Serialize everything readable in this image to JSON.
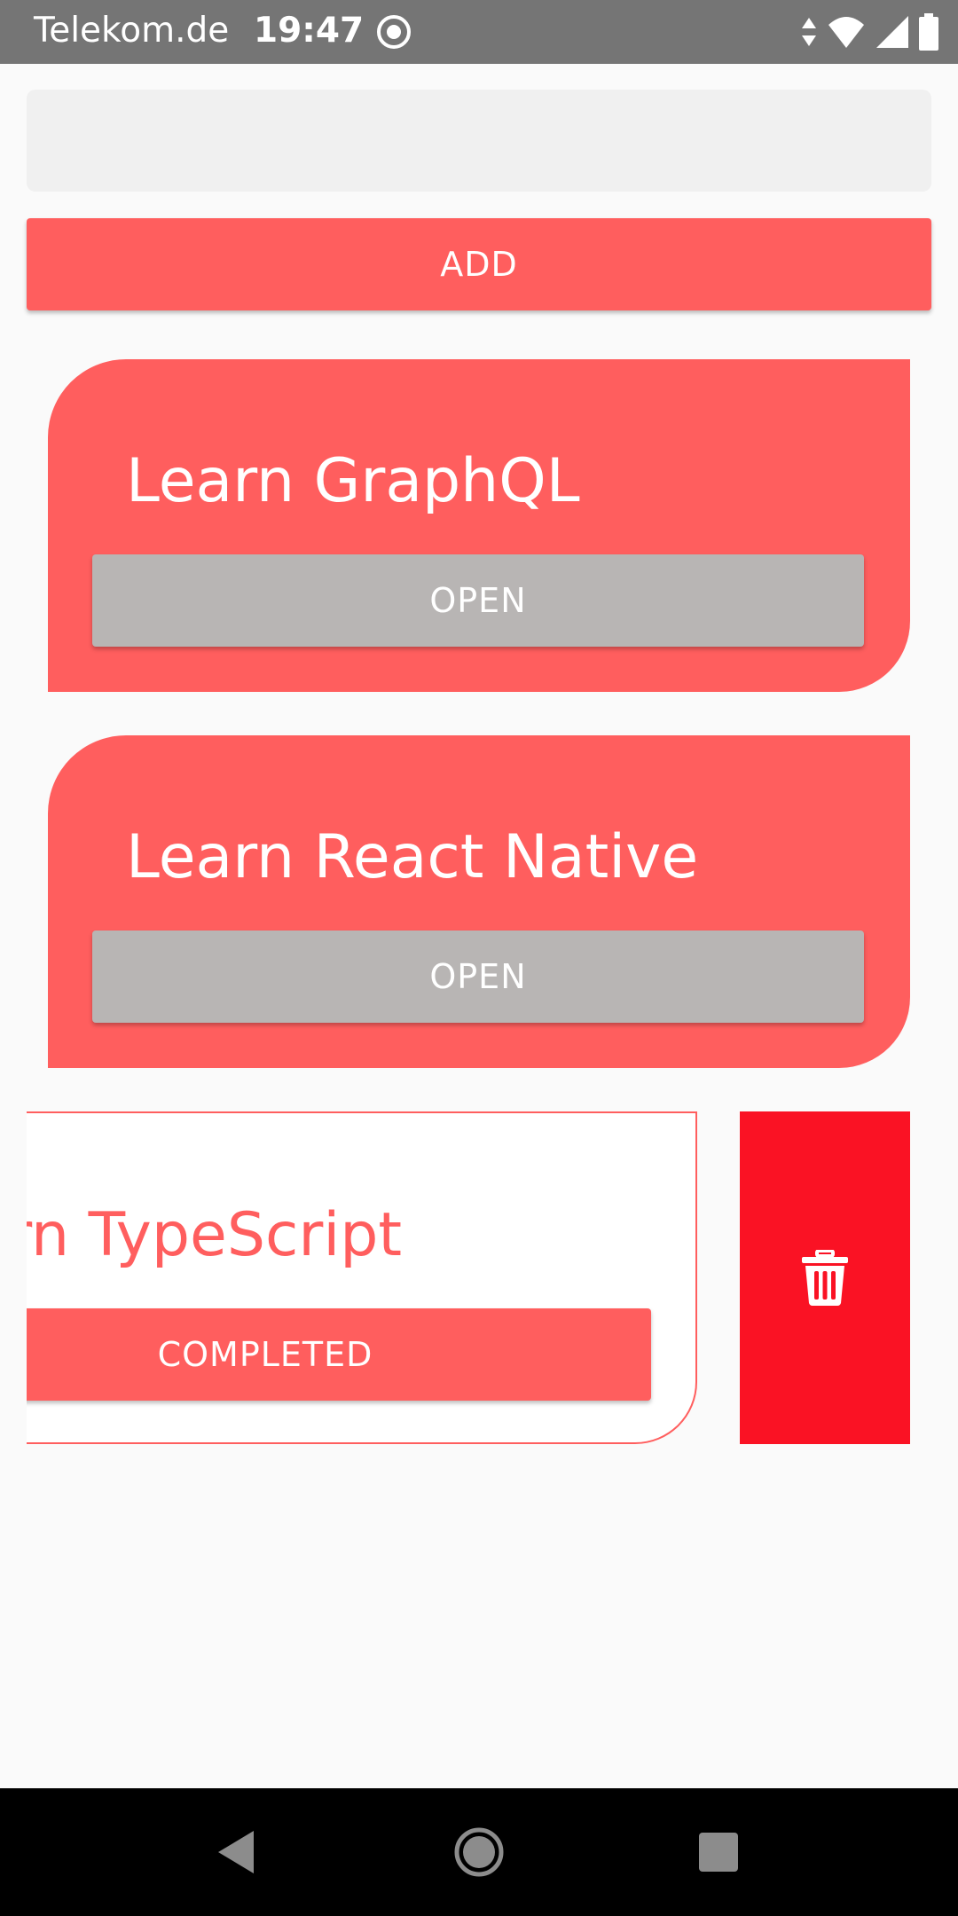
{
  "status_bar": {
    "carrier": "Telekom.de",
    "time": "19:47",
    "icons": [
      "sync-icon",
      "data-arrows-icon",
      "wifi-icon",
      "cellular-signal-icon",
      "battery-icon"
    ]
  },
  "todo_input": {
    "value": "",
    "placeholder": ""
  },
  "add_button": {
    "label": "ADD"
  },
  "todos": [
    {
      "title": "Learn GraphQL",
      "status": "OPEN"
    },
    {
      "title": "Learn React Native",
      "status": "OPEN"
    },
    {
      "title": "Learn TypeScript",
      "status": "COMPLETED"
    }
  ],
  "swipe_action": {
    "icon": "trash-icon"
  },
  "nav_bar": {
    "icons": [
      "back-icon",
      "home-icon",
      "recents-icon"
    ]
  },
  "colors": {
    "accent": "#ff5e5e",
    "open_button": "#b8b5b4",
    "delete": "#fa1224",
    "status_bar": "#757575",
    "background": "#fafafa"
  }
}
